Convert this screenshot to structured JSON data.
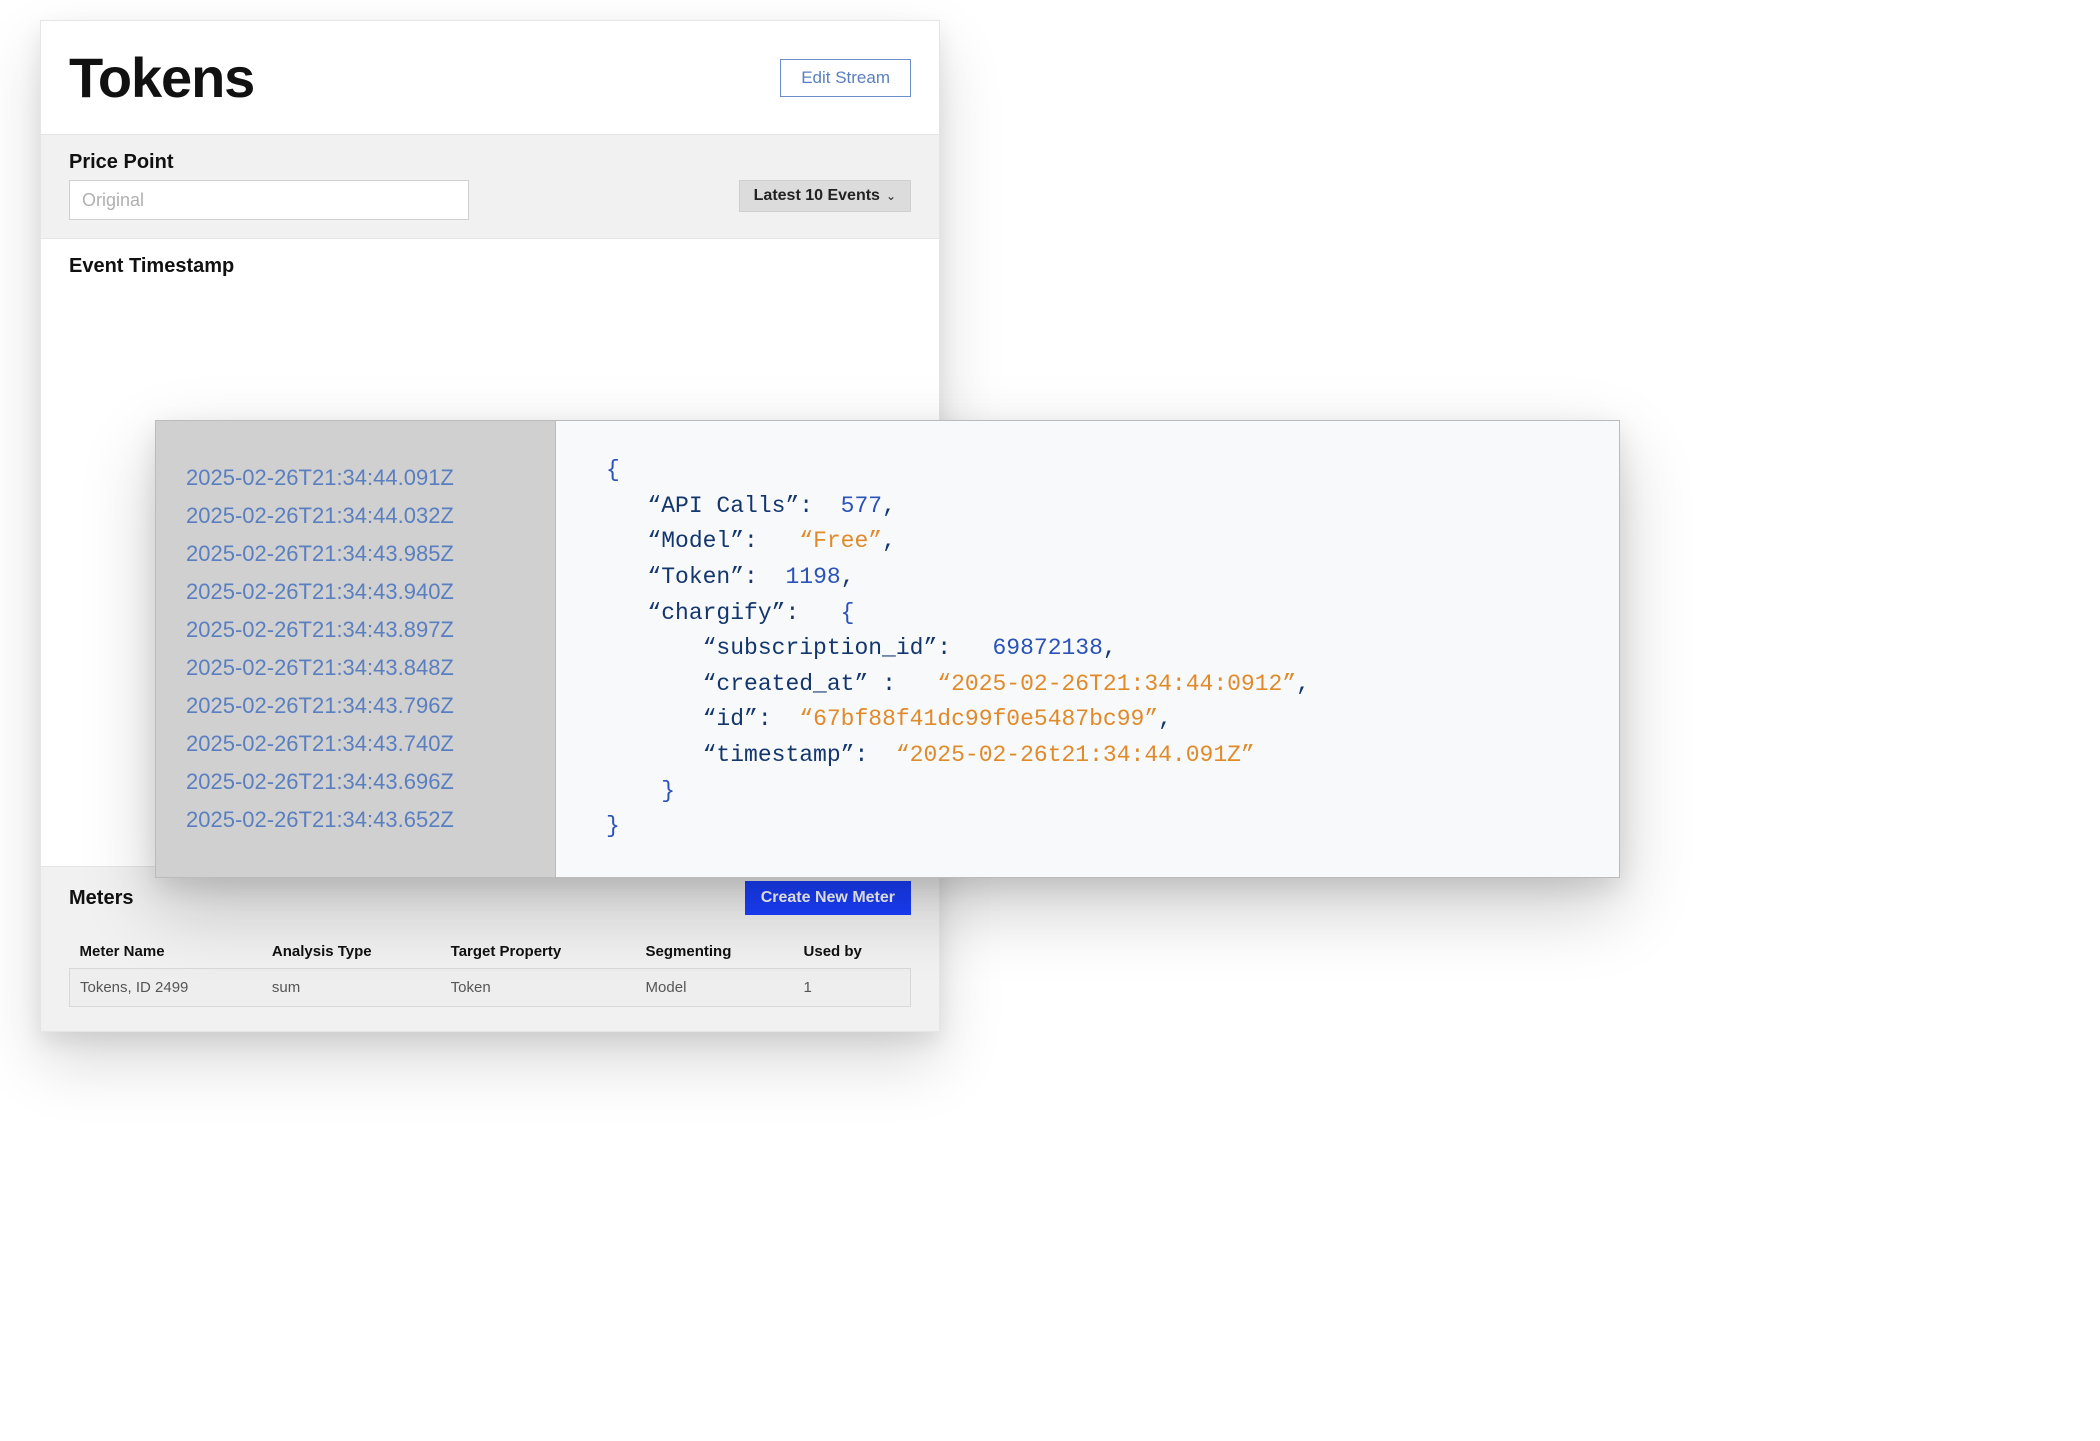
{
  "header": {
    "title": "Tokens",
    "edit_button": "Edit Stream"
  },
  "price_point": {
    "label": "Price Point",
    "placeholder": "Original",
    "value": "",
    "dropdown_label": "Latest 10 Events"
  },
  "event_timestamp": {
    "label": "Event Timestamp",
    "items": [
      "2025-02-26T21:34:44.091Z",
      "2025-02-26T21:34:44.032Z",
      "2025-02-26T21:34:43.985Z",
      "2025-02-26T21:34:43.940Z",
      "2025-02-26T21:34:43.897Z",
      "2025-02-26T21:34:43.848Z",
      "2025-02-26T21:34:43.796Z",
      "2025-02-26T21:34:43.740Z",
      "2025-02-26T21:34:43.696Z",
      "2025-02-26T21:34:43.652Z"
    ]
  },
  "event_detail": {
    "api_calls_key": "“API Calls”",
    "api_calls_val": "577",
    "model_key": "“Model”",
    "model_val": "“Free”",
    "token_key": "“Token”",
    "token_val": "1198",
    "chargify_key": "“chargify”",
    "sub_id_key": "“subscription_id”",
    "sub_id_val": "69872138",
    "created_at_key": "“created_at”",
    "created_at_val": "“2025-02-26T21:34:44:0912”",
    "id_key": "“id”",
    "id_val": "“67bf88f41dc99f0e5487bc99”",
    "timestamp_key": "“timestamp”",
    "timestamp_val": "“2025-02-26t21:34:44.091Z”"
  },
  "meters": {
    "label": "Meters",
    "create_button": "Create New Meter",
    "columns": [
      "Meter Name",
      "Analysis Type",
      "Target Property",
      "Segmenting",
      "Used by"
    ],
    "rows": [
      {
        "name": "Tokens, ID 2499",
        "analysis": "sum",
        "target": "Token",
        "segmenting": "Model",
        "used_by": "1"
      }
    ]
  }
}
